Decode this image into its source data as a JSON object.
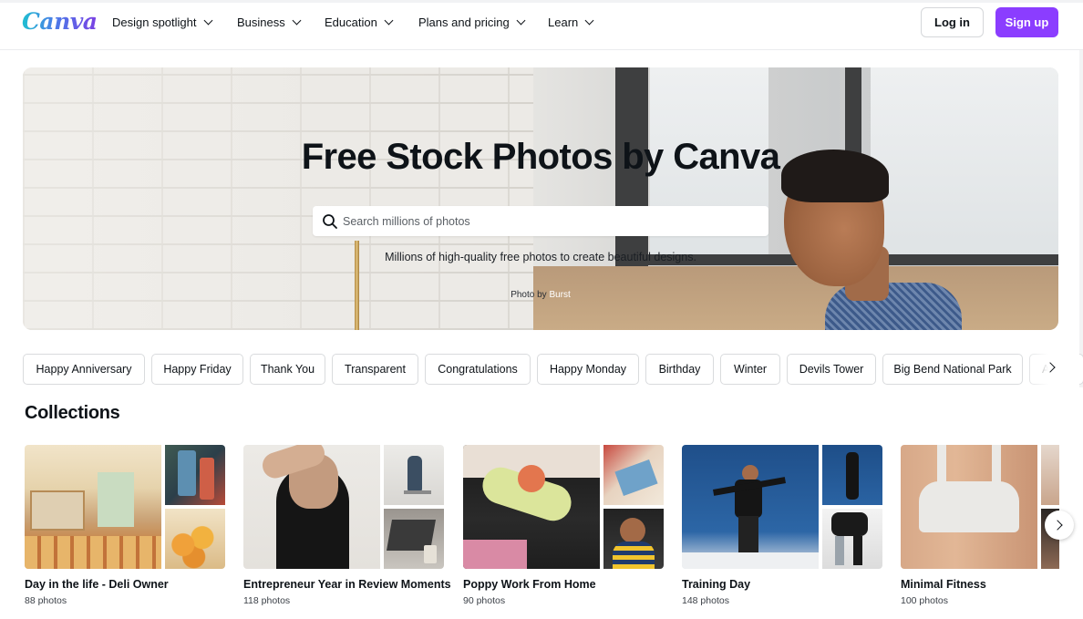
{
  "brand": {
    "logo_text": "Canva",
    "accent": "#8b3dff"
  },
  "nav": {
    "items": [
      {
        "label": "Design spotlight"
      },
      {
        "label": "Business"
      },
      {
        "label": "Education"
      },
      {
        "label": "Plans and pricing"
      },
      {
        "label": "Learn"
      }
    ],
    "login_label": "Log in",
    "signup_label": "Sign up"
  },
  "hero": {
    "title": "Free Stock Photos by Canva",
    "search_placeholder": "Search millions of photos",
    "subtitle": "Millions of high-quality free photos to create beautiful designs.",
    "credit_prefix": "Photo by ",
    "credit_author": "Burst"
  },
  "tags": [
    "Happy Anniversary",
    "Happy Friday",
    "Thank You",
    "Transparent",
    "Congratulations",
    "Happy Monday",
    "Birthday",
    "Winter",
    "Devils Tower",
    "Big Bend National Park",
    "Ar"
  ],
  "collections": {
    "heading": "Collections",
    "items": [
      {
        "title": "Day in the life - Deli Owner",
        "count": "88 photos"
      },
      {
        "title": "Entrepreneur Year in Review Moments",
        "count": "118 photos"
      },
      {
        "title": "Poppy Work From Home",
        "count": "90 photos"
      },
      {
        "title": "Training Day",
        "count": "148 photos"
      },
      {
        "title": "Minimal Fitness",
        "count": "100 photos"
      }
    ]
  }
}
